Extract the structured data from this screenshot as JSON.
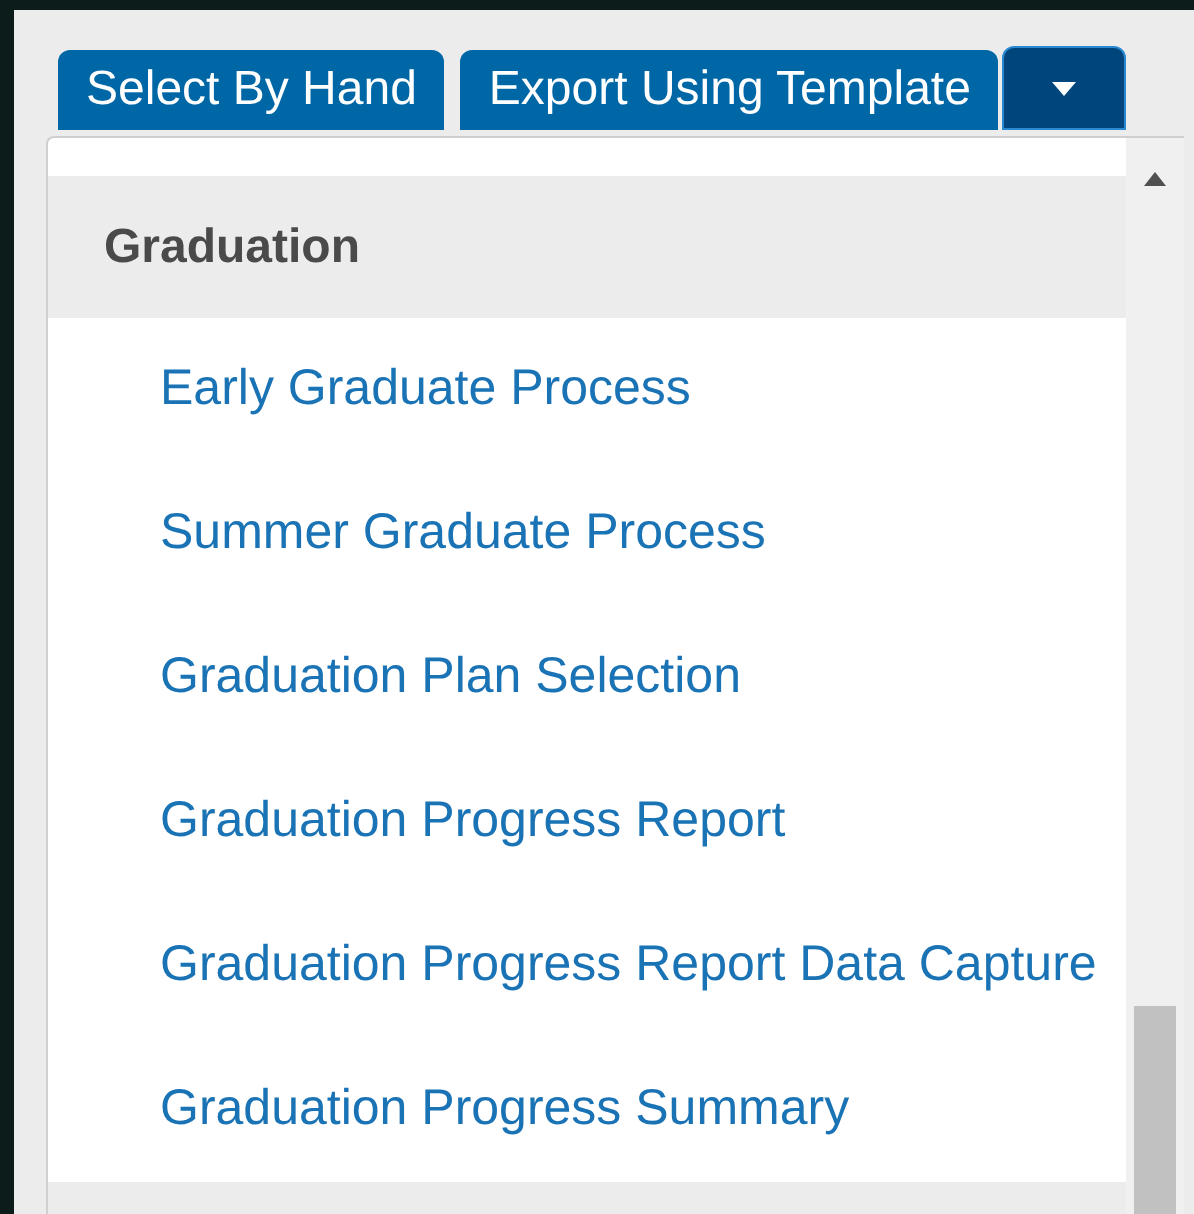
{
  "toolbar": {
    "buttons": [
      {
        "kind": "text",
        "label": "Select By Hand"
      },
      {
        "kind": "text",
        "label": "Export Using Template"
      },
      {
        "kind": "caret"
      }
    ]
  },
  "dropdown": {
    "groups": [
      {
        "title": "Graduation",
        "items": [
          {
            "label": "Early Graduate Process"
          },
          {
            "label": "Summer Graduate Process"
          },
          {
            "label": "Graduation Plan Selection"
          },
          {
            "label": "Graduation Progress Report"
          },
          {
            "label": "Graduation Progress Report Data Capture"
          },
          {
            "label": "Graduation Progress Summary"
          }
        ]
      }
    ]
  }
}
